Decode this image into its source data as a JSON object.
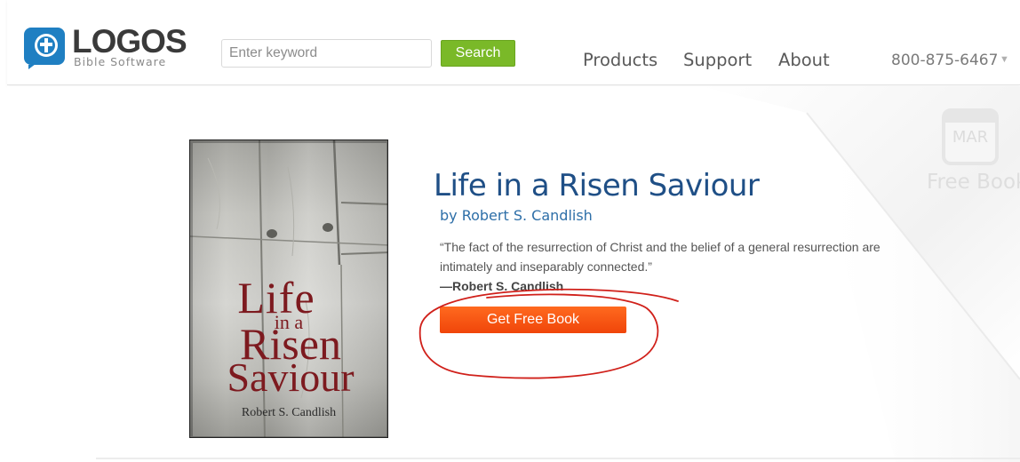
{
  "header": {
    "logo": {
      "word": "LOGOS",
      "subtitle": "Bible Software",
      "icon": "bible-cross-icon"
    },
    "search": {
      "placeholder": "Enter keyword",
      "value": "",
      "button_label": "Search"
    },
    "nav": {
      "products": "Products",
      "support": "Support",
      "about": "About"
    },
    "phone": "800-875-6467",
    "colors": {
      "search_button": "#7ab928",
      "nav_text": "#5a5a5a",
      "logo_blue": "#1f7fc2"
    }
  },
  "book": {
    "title": "Life in a Risen Saviour",
    "author": "by Robert S. Candlish",
    "quote": "“The fact of the resurrection of Christ and the belief of a general resurrection are intimately and inseparably connected.”",
    "quote_attribution": "—Robert S. Candlish",
    "cta_label": "Get Free Book",
    "cover": {
      "title_line1": "Life",
      "title_line2": "in a",
      "title_line3": "Risen",
      "title_line4": "Saviour",
      "author": "Robert S. Candlish"
    },
    "colors": {
      "title": "#1f4f86",
      "author": "#2e6fa8",
      "cta": "#f0450a",
      "cover_title": "#7d1a1f"
    }
  },
  "free_book_widget": {
    "month": "MAR",
    "label": "Free Book",
    "icon": "calendar-icon"
  },
  "annotation": {
    "shape": "red-hand-drawn-circle",
    "color": "#d0201a",
    "circled_element": "get-free-book-button"
  }
}
